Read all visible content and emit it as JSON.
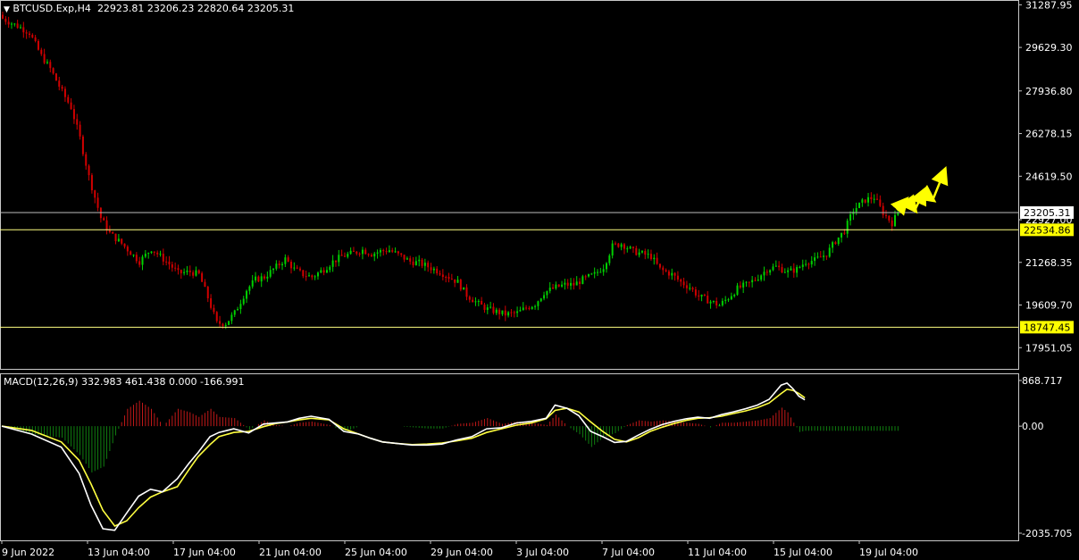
{
  "header": {
    "menu_glyph": "▼",
    "symbol": "BTCUSD.Exp,H4",
    "ohlc": "22923.81 23206.23 22820.64 23205.31"
  },
  "macd_header": "MACD(12,26,9) 332.983 461.438 0.000 -166.991",
  "colors": {
    "background": "#000000",
    "bull": "#00d000",
    "bear": "#d00000",
    "axis": "#c8c8c8",
    "level_line": "#ffff80",
    "price_line": "#bbbbbb",
    "macd_line": "#ffffff",
    "signal_line": "#ffff40",
    "hist_pos": "#c01818",
    "hist_neg": "#108010",
    "arrows": "#ffff00",
    "level_tag_bg": "#ffff00"
  },
  "chart_data": [
    {
      "type": "candlestick",
      "symbol": "BTCUSD.Exp",
      "timeframe": "H4",
      "y_range": [
        17300,
        31300
      ],
      "y_ticks": [
        31287.95,
        29629.3,
        27936.8,
        26278.15,
        24619.5,
        22927,
        21268.35,
        19609.7,
        17951.05
      ],
      "y_tick_labels": [
        "31287.95",
        "29629.30",
        "27936.80",
        "26278.15",
        "24619.50",
        "22927.00",
        "21268.35",
        "19609.70",
        "17951.05"
      ],
      "x_labels": [
        "9 Jun 2022",
        "13 Jun 04:00",
        "17 Jun 04:00",
        "21 Jun 04:00",
        "25 Jun 04:00",
        "29 Jun 04:00",
        "3 Jul 04:00",
        "7 Jul 04:00",
        "11 Jul 04:00",
        "15 Jul 04:00",
        "19 Jul 04:00"
      ],
      "current_price": 23205.31,
      "current_price_label": "23205.31",
      "levels": [
        22534.86,
        18747.45
      ],
      "level_labels": [
        "22534.86",
        "18747.45"
      ],
      "close_path": [
        [
          0,
          30750
        ],
        [
          6,
          30400
        ],
        [
          9,
          30200
        ],
        [
          13,
          29300
        ],
        [
          16,
          28800
        ],
        [
          20,
          27900
        ],
        [
          23,
          27300
        ],
        [
          26,
          26100
        ],
        [
          29,
          24600
        ],
        [
          33,
          23000
        ],
        [
          36,
          22400
        ],
        [
          40,
          22000
        ],
        [
          43,
          21650
        ],
        [
          46,
          21300
        ],
        [
          50,
          21800
        ],
        [
          53,
          21500
        ],
        [
          56,
          21200
        ],
        [
          59,
          20850
        ],
        [
          63,
          20900
        ],
        [
          66,
          20800
        ],
        [
          69,
          19900
        ],
        [
          72,
          18900
        ],
        [
          75,
          18900
        ],
        [
          78,
          19300
        ],
        [
          82,
          20200
        ],
        [
          85,
          20600
        ],
        [
          88,
          20700
        ],
        [
          91,
          21000
        ],
        [
          95,
          21400
        ],
        [
          98,
          21000
        ],
        [
          101,
          20800
        ],
        [
          104,
          20700
        ],
        [
          108,
          21000
        ],
        [
          111,
          21300
        ],
        [
          114,
          21500
        ],
        [
          117,
          21600
        ],
        [
          121,
          21750
        ],
        [
          124,
          21600
        ],
        [
          127,
          21700
        ],
        [
          130,
          21750
        ],
        [
          134,
          21500
        ],
        [
          137,
          21300
        ],
        [
          140,
          21250
        ],
        [
          143,
          21100
        ],
        [
          147,
          20900
        ],
        [
          150,
          20700
        ],
        [
          153,
          20500
        ],
        [
          156,
          20000
        ],
        [
          160,
          19650
        ],
        [
          163,
          19450
        ],
        [
          166,
          19350
        ],
        [
          169,
          19250
        ],
        [
          173,
          19300
        ],
        [
          176,
          19500
        ],
        [
          179,
          19650
        ],
        [
          182,
          20100
        ],
        [
          186,
          20300
        ],
        [
          189,
          20400
        ],
        [
          192,
          20400
        ],
        [
          195,
          20600
        ],
        [
          199,
          20800
        ],
        [
          202,
          21100
        ],
        [
          205,
          21900
        ],
        [
          208,
          22000
        ],
        [
          212,
          21700
        ],
        [
          215,
          21600
        ],
        [
          218,
          21500
        ],
        [
          221,
          21000
        ],
        [
          225,
          20800
        ],
        [
          228,
          20500
        ],
        [
          231,
          20300
        ],
        [
          234,
          19950
        ],
        [
          238,
          19750
        ],
        [
          241,
          19600
        ],
        [
          244,
          19900
        ],
        [
          247,
          20250
        ],
        [
          251,
          20450
        ],
        [
          254,
          20700
        ],
        [
          257,
          21000
        ],
        [
          260,
          21100
        ],
        [
          264,
          20900
        ],
        [
          267,
          21000
        ],
        [
          270,
          21300
        ],
        [
          273,
          21350
        ],
        [
          277,
          21600
        ],
        [
          280,
          22100
        ],
        [
          283,
          22500
        ],
        [
          286,
          23300
        ],
        [
          290,
          23700
        ],
        [
          293,
          23800
        ],
        [
          296,
          23200
        ],
        [
          299,
          22800
        ],
        [
          301,
          23205
        ]
      ],
      "projection_arrows": [
        [
          301,
          23300,
          304,
          23700
        ],
        [
          304,
          23750,
          307,
          23300
        ],
        [
          307,
          23300,
          310,
          24050
        ],
        [
          310,
          23950,
          313,
          23700
        ],
        [
          313,
          23700,
          317,
          24850
        ]
      ]
    },
    {
      "type": "macd",
      "params": "12,26,9",
      "y_range": [
        -2035.705,
        868.717
      ],
      "y_tick_labels": [
        "868.717",
        "0.00",
        "-2035.705"
      ],
      "macd_path": [
        [
          0,
          0
        ],
        [
          10,
          -150
        ],
        [
          20,
          -400
        ],
        [
          26,
          -900
        ],
        [
          30,
          -1500
        ],
        [
          34,
          -1950
        ],
        [
          38,
          -1980
        ],
        [
          42,
          -1650
        ],
        [
          46,
          -1330
        ],
        [
          50,
          -1200
        ],
        [
          54,
          -1250
        ],
        [
          59,
          -1000
        ],
        [
          63,
          -700
        ],
        [
          66,
          -500
        ],
        [
          70,
          -200
        ],
        [
          73,
          -120
        ],
        [
          78,
          -50
        ],
        [
          83,
          -130
        ],
        [
          88,
          40
        ],
        [
          92,
          60
        ],
        [
          96,
          80
        ],
        [
          100,
          150
        ],
        [
          104,
          190
        ],
        [
          110,
          130
        ],
        [
          115,
          -100
        ],
        [
          120,
          -150
        ],
        [
          124,
          -230
        ],
        [
          128,
          -300
        ],
        [
          133,
          -330
        ],
        [
          138,
          -360
        ],
        [
          143,
          -360
        ],
        [
          148,
          -340
        ],
        [
          153,
          -260
        ],
        [
          158,
          -200
        ],
        [
          163,
          -50
        ],
        [
          168,
          -30
        ],
        [
          173,
          60
        ],
        [
          178,
          90
        ],
        [
          183,
          150
        ],
        [
          186,
          400
        ],
        [
          190,
          340
        ],
        [
          194,
          200
        ],
        [
          198,
          -100
        ],
        [
          202,
          -200
        ],
        [
          206,
          -310
        ],
        [
          210,
          -290
        ],
        [
          214,
          -170
        ],
        [
          218,
          -60
        ],
        [
          222,
          30
        ],
        [
          226,
          90
        ],
        [
          230,
          140
        ],
        [
          234,
          170
        ],
        [
          238,
          150
        ],
        [
          242,
          220
        ],
        [
          246,
          270
        ],
        [
          250,
          330
        ],
        [
          254,
          400
        ],
        [
          258,
          510
        ],
        [
          262,
          780
        ],
        [
          264,
          820
        ],
        [
          266,
          710
        ],
        [
          268,
          570
        ],
        [
          270,
          500
        ]
      ],
      "signal_path": [
        [
          0,
          0
        ],
        [
          10,
          -80
        ],
        [
          20,
          -300
        ],
        [
          26,
          -650
        ],
        [
          30,
          -1100
        ],
        [
          34,
          -1600
        ],
        [
          38,
          -1900
        ],
        [
          42,
          -1800
        ],
        [
          46,
          -1550
        ],
        [
          50,
          -1350
        ],
        [
          54,
          -1250
        ],
        [
          59,
          -1150
        ],
        [
          63,
          -820
        ],
        [
          66,
          -580
        ],
        [
          70,
          -350
        ],
        [
          73,
          -200
        ],
        [
          78,
          -120
        ],
        [
          83,
          -100
        ],
        [
          88,
          -10
        ],
        [
          92,
          50
        ],
        [
          96,
          80
        ],
        [
          100,
          120
        ],
        [
          104,
          150
        ],
        [
          110,
          120
        ],
        [
          115,
          -50
        ],
        [
          120,
          -150
        ],
        [
          124,
          -230
        ],
        [
          128,
          -300
        ],
        [
          133,
          -330
        ],
        [
          138,
          -350
        ],
        [
          143,
          -340
        ],
        [
          148,
          -320
        ],
        [
          153,
          -280
        ],
        [
          158,
          -230
        ],
        [
          163,
          -120
        ],
        [
          168,
          -50
        ],
        [
          173,
          20
        ],
        [
          178,
          60
        ],
        [
          183,
          140
        ],
        [
          186,
          300
        ],
        [
          190,
          340
        ],
        [
          194,
          270
        ],
        [
          198,
          80
        ],
        [
          202,
          -100
        ],
        [
          206,
          -250
        ],
        [
          210,
          -300
        ],
        [
          214,
          -220
        ],
        [
          218,
          -100
        ],
        [
          222,
          -20
        ],
        [
          226,
          50
        ],
        [
          230,
          110
        ],
        [
          234,
          150
        ],
        [
          238,
          160
        ],
        [
          242,
          190
        ],
        [
          246,
          240
        ],
        [
          250,
          290
        ],
        [
          254,
          350
        ],
        [
          258,
          440
        ],
        [
          262,
          620
        ],
        [
          264,
          700
        ],
        [
          266,
          680
        ],
        [
          268,
          620
        ],
        [
          270,
          540
        ]
      ],
      "histogram": {
        "positive_ranges": [
          [
            42,
            56
          ],
          [
            63,
            83
          ],
          [
            140,
            150
          ],
          [
            212,
            240
          ],
          [
            254,
            262
          ]
        ],
        "negative_ranges": [
          [
            10,
            35
          ],
          [
            56,
            62
          ],
          [
            115,
            140
          ],
          [
            194,
            212
          ],
          [
            262,
            270
          ]
        ]
      }
    }
  ]
}
